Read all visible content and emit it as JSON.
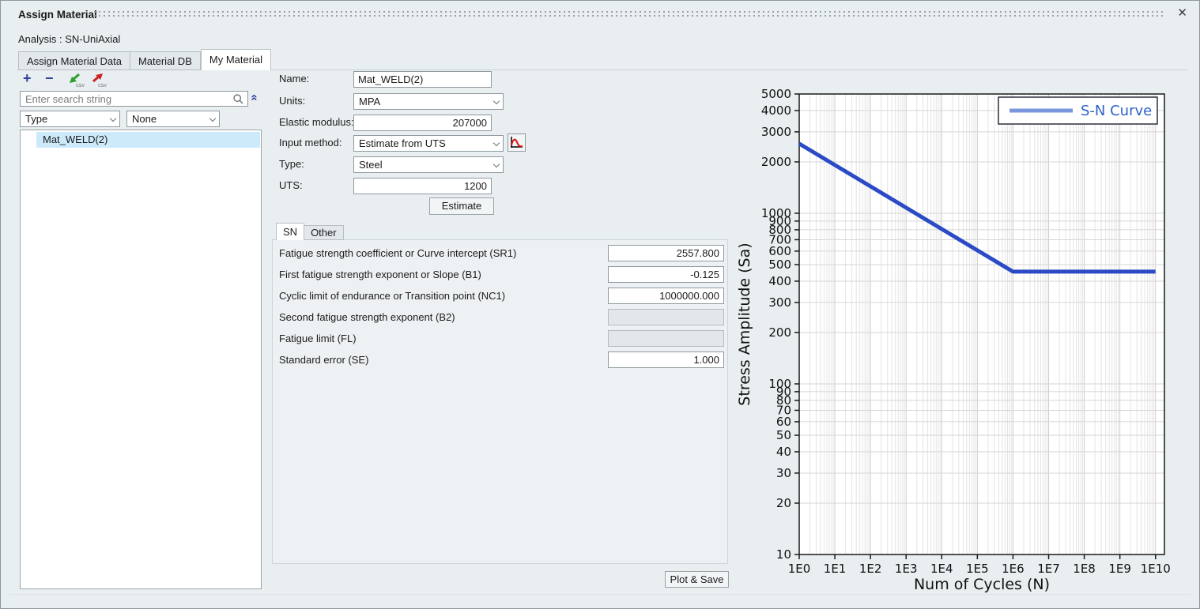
{
  "window": {
    "title": "Assign Material",
    "close_icon": "✕"
  },
  "header": {
    "analysis_label": "Analysis : SN-UniAxial"
  },
  "tabs": {
    "items": [
      {
        "label": "Assign Material Data",
        "active": false
      },
      {
        "label": "Material DB",
        "active": false
      },
      {
        "label": "My Material",
        "active": true
      }
    ]
  },
  "left": {
    "toolbar": {
      "add_label": "+",
      "remove_label": "−",
      "import_csv_label": "CSV",
      "export_csv_label": "CSV"
    },
    "search": {
      "placeholder": "Enter search string"
    },
    "collapse_icon": "«",
    "filter_type_value": "Type",
    "filter_value_value": "None",
    "items": [
      "Mat_WELD(2)"
    ]
  },
  "form": {
    "name_label": "Name:",
    "name_value": "Mat_WELD(2)",
    "units_label": "Units:",
    "units_value": "MPA",
    "elastic_label": "Elastic modulus:",
    "elastic_value": "207000",
    "input_method_label": "Input method:",
    "input_method_value": "Estimate from UTS",
    "type_label": "Type:",
    "type_value": "Steel",
    "uts_label": "UTS:",
    "uts_value": "1200",
    "estimate_label": "Estimate"
  },
  "sn": {
    "tabs": [
      {
        "label": "SN",
        "active": true
      },
      {
        "label": "Other",
        "active": false
      }
    ],
    "rows": [
      {
        "label": "Fatigue strength coefficient or Curve intercept (SR1)",
        "value": "2557.800",
        "disabled": false
      },
      {
        "label": "First fatigue strength exponent or Slope (B1)",
        "value": "-0.125",
        "disabled": false
      },
      {
        "label": "Cyclic limit of endurance or Transition point (NC1)",
        "value": "1000000.000",
        "disabled": false
      },
      {
        "label": "Second fatigue strength exponent (B2)",
        "value": "",
        "disabled": true
      },
      {
        "label": "Fatigue limit (FL)",
        "value": "",
        "disabled": true
      },
      {
        "label": "Standard error (SE)",
        "value": "1.000",
        "disabled": false
      }
    ],
    "plot_save_label": "Plot & Save"
  },
  "chart_data": {
    "type": "line",
    "title": "",
    "xlabel": "Num of Cycles (N)",
    "ylabel": "Stress Amplitude (Sa)",
    "x_scale": "log",
    "y_scale": "log",
    "xlim": [
      1,
      10000000000
    ],
    "ylim": [
      10,
      5000
    ],
    "grid": true,
    "x_ticks": [
      {
        "value": 1,
        "label": "1E0"
      },
      {
        "value": 10,
        "label": "1E1"
      },
      {
        "value": 100,
        "label": "1E2"
      },
      {
        "value": 1000,
        "label": "1E3"
      },
      {
        "value": 10000,
        "label": "1E4"
      },
      {
        "value": 100000,
        "label": "1E5"
      },
      {
        "value": 1000000,
        "label": "1E6"
      },
      {
        "value": 10000000,
        "label": "1E7"
      },
      {
        "value": 100000000,
        "label": "1E8"
      },
      {
        "value": 1000000000,
        "label": "1E9"
      },
      {
        "value": 10000000000,
        "label": "1E10"
      }
    ],
    "y_ticks": [
      10,
      20,
      30,
      40,
      50,
      60,
      70,
      80,
      90,
      100,
      200,
      300,
      400,
      500,
      600,
      700,
      800,
      900,
      1000,
      2000,
      3000,
      4000,
      5000
    ],
    "series": [
      {
        "name": "S-N Curve",
        "color": "#2b4ac6",
        "points": [
          [
            1,
            2557.8
          ],
          [
            1000000,
            454.9
          ],
          [
            10000000000,
            454.9
          ]
        ]
      }
    ],
    "legend": {
      "position": "top-right",
      "label": "S-N Curve",
      "line_color": "#7b97dd",
      "text_color": "#2e62c8"
    }
  }
}
